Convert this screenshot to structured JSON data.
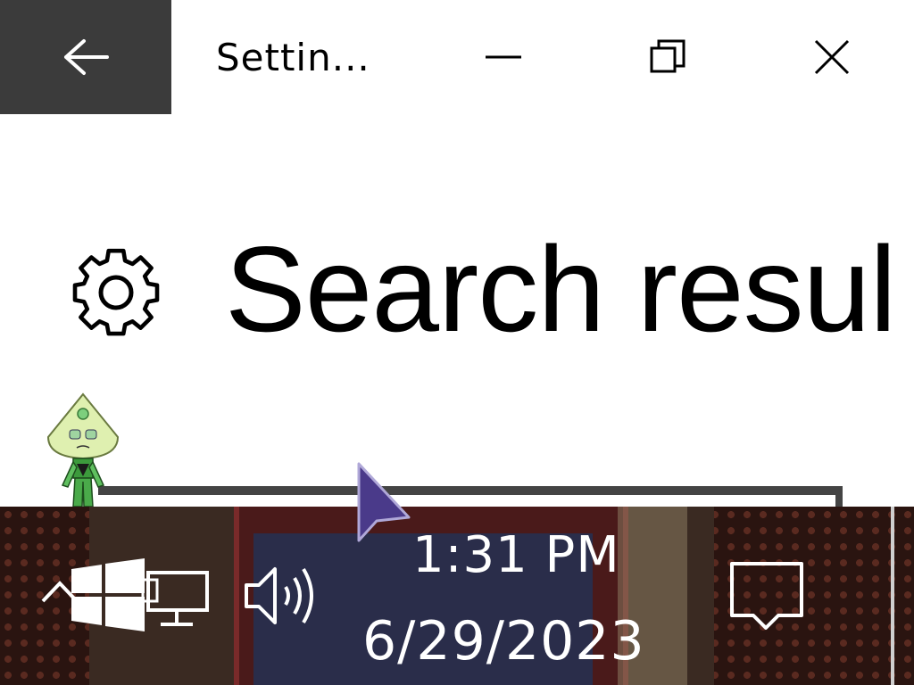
{
  "window": {
    "title": "Settin...",
    "heading": "Search resul"
  },
  "icons": {
    "back": "back-arrow-icon",
    "minimize": "minimize-icon",
    "maximize": "restore-icon",
    "close": "close-icon",
    "settings": "gear-icon",
    "show_hidden": "chevron-up-icon",
    "start": "windows-logo-icon",
    "network": "network-monitor-icon",
    "volume": "volume-icon",
    "notifications": "action-center-icon"
  },
  "taskbar": {
    "time": "1:31 PM",
    "date": "6/29/2023"
  },
  "colors": {
    "back_button_bg": "#3b3b3b",
    "progress_track": "#444444",
    "taskbar_bg": "#2a1410"
  }
}
